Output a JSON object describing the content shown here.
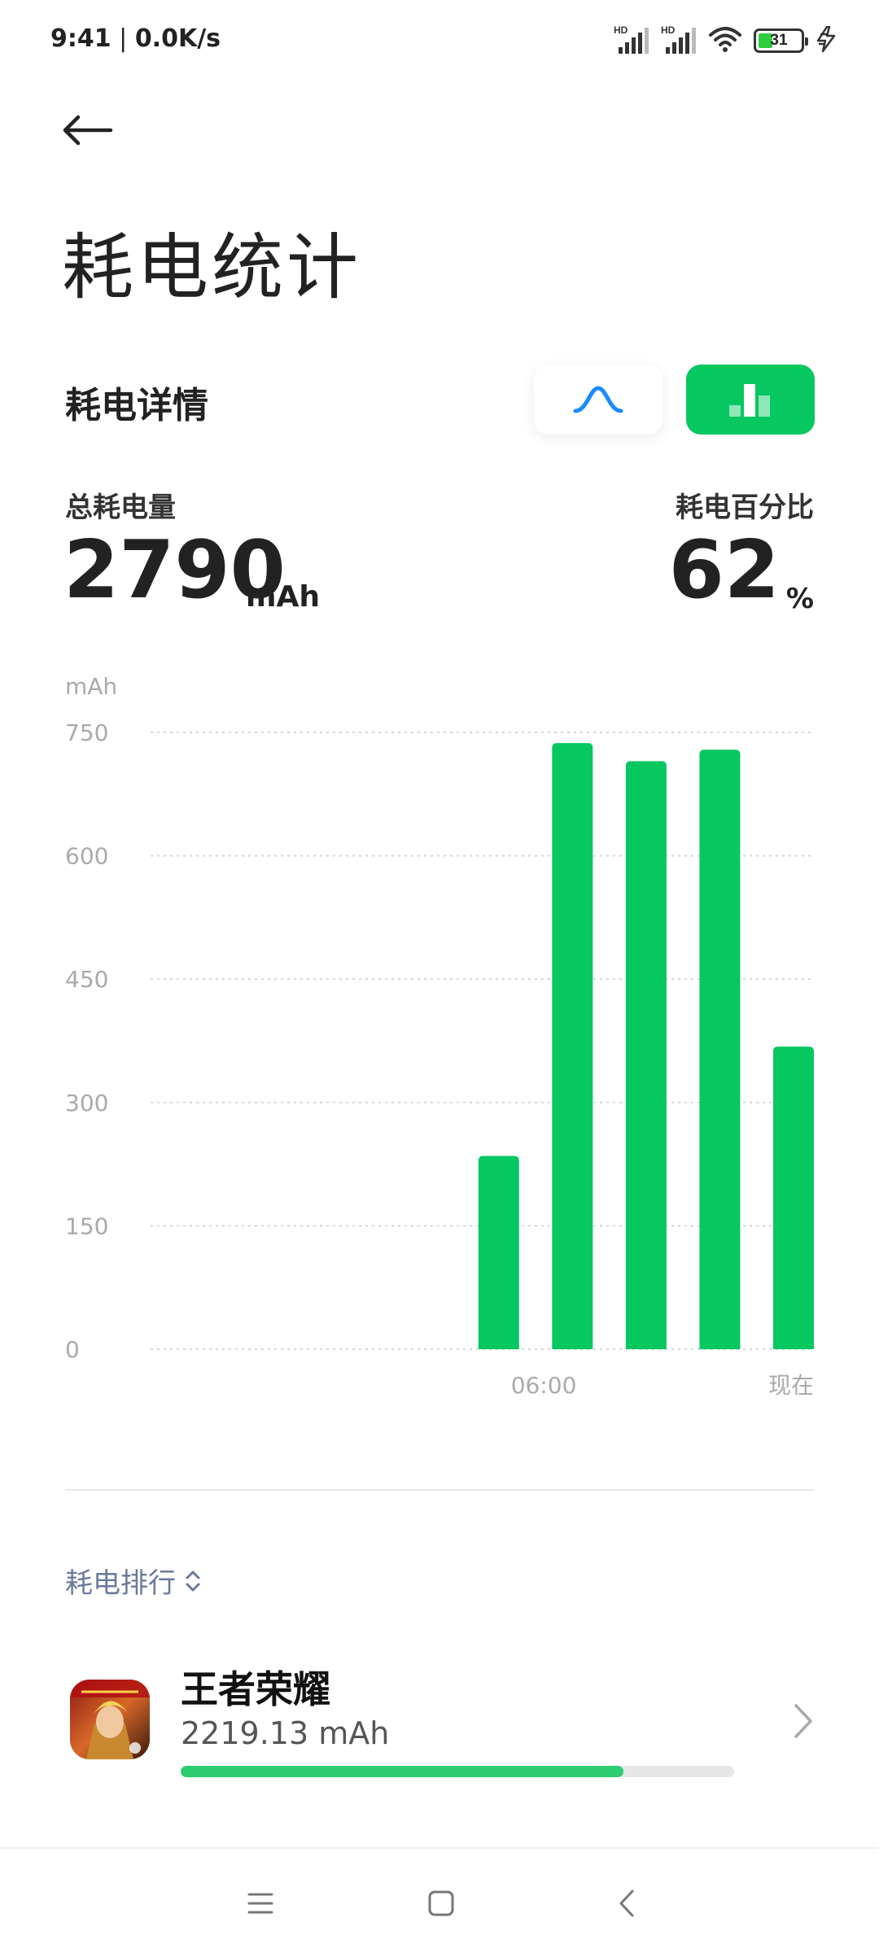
{
  "status_bar": {
    "time": "9:41",
    "speed": "0.0K/s",
    "sim1_label": "HD",
    "sim2_label": "HD",
    "battery_level": "31",
    "battery_fraction": 0.31,
    "icons": [
      "signal-hd-icon",
      "signal-hd-icon",
      "wifi-icon",
      "battery-icon",
      "charging-bolt-icon"
    ]
  },
  "header": {
    "back_icon": "back-arrow-icon",
    "title": "耗电统计"
  },
  "details": {
    "section_title": "耗电详情",
    "view_toggle": {
      "curve_icon": "curve-icon",
      "bar_icon": "bar-chart-icon",
      "selected": "bar"
    },
    "total_label": "总耗电量",
    "total_value": "2790",
    "total_unit": "mAh",
    "percent_label": "耗电百分比",
    "percent_value": "62",
    "percent_unit": "%"
  },
  "chart_data": {
    "type": "bar",
    "ylabel": "mAh",
    "yticks": [
      0,
      150,
      300,
      450,
      600,
      750
    ],
    "ylim": [
      0,
      750
    ],
    "xtick_labels": [
      {
        "slot": 5,
        "label": "06:00"
      },
      {
        "slot": 8,
        "label": "现在"
      }
    ],
    "slots": 9,
    "values": [
      0,
      0,
      0,
      0,
      235,
      737,
      715,
      729,
      368
    ],
    "grid": true,
    "color": "#07c760"
  },
  "ranking": {
    "label": "耗电排行",
    "sort_icon": "sort-updown-icon",
    "items": [
      {
        "name": "王者荣耀",
        "usage": "2219.13 mAh",
        "progress": 0.8,
        "icon": "game-app-icon",
        "chevron": "chevron-right-icon"
      }
    ]
  },
  "nav_bar": {
    "menu_icon": "menu-icon",
    "home_icon": "home-icon",
    "back_icon": "back-icon"
  },
  "colors": {
    "accent_green": "#07c760",
    "progress_green": "#2ecc71",
    "curve_blue": "#1a8cff",
    "ranking_label": "#6a7a9a"
  }
}
